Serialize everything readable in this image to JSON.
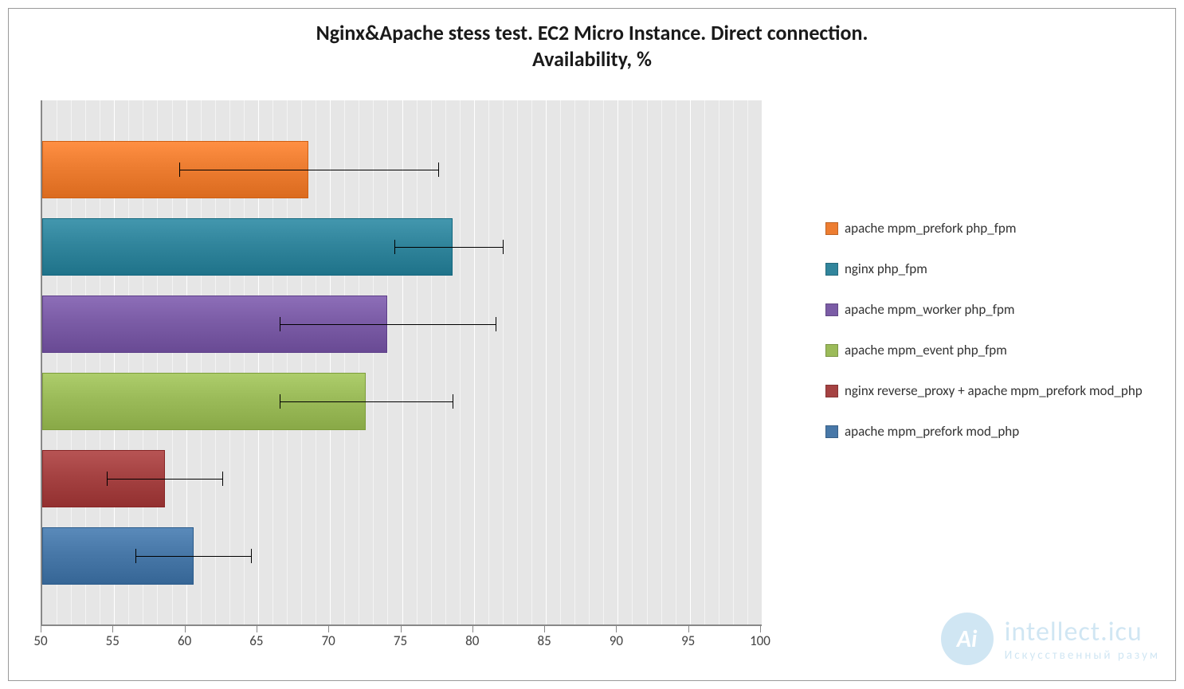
{
  "chart_data": {
    "type": "bar",
    "orientation": "horizontal",
    "title": "Nginx&Apache stess test. EC2 Micro Instance. Direct connection.\nAvailability, %",
    "xlabel": "",
    "ylabel": "",
    "xlim": [
      50,
      100
    ],
    "x_ticks": [
      50,
      55,
      60,
      65,
      70,
      75,
      80,
      85,
      90,
      95,
      100
    ],
    "minor_grid_interval": 1,
    "series": [
      {
        "name": "apache mpm_prefork php_fpm",
        "color": "#ed7d31",
        "value": 68.5,
        "err_low": 59.5,
        "err_high": 77.5
      },
      {
        "name": "nginx php_fpm",
        "color": "#31859c",
        "value": 78.5,
        "err_low": 74.5,
        "err_high": 82.0
      },
      {
        "name": "apache mpm_worker php_fpm",
        "color": "#7b5ca6",
        "value": 74.0,
        "err_low": 66.5,
        "err_high": 81.5
      },
      {
        "name": "apache mpm_event php_fpm",
        "color": "#9bbb59",
        "value": 72.5,
        "err_low": 66.5,
        "err_high": 78.5
      },
      {
        "name": "nginx reverse_proxy + apache mpm_prefork mod_php",
        "color": "#a54242",
        "value": 58.5,
        "err_low": 54.5,
        "err_high": 62.5
      },
      {
        "name": "apache mpm_prefork mod_php",
        "color": "#4878a8",
        "value": 60.5,
        "err_low": 56.5,
        "err_high": 64.5
      }
    ]
  },
  "watermark": {
    "badge": "Ai",
    "main": "intellect.icu",
    "sub": "Искусственный разум"
  }
}
